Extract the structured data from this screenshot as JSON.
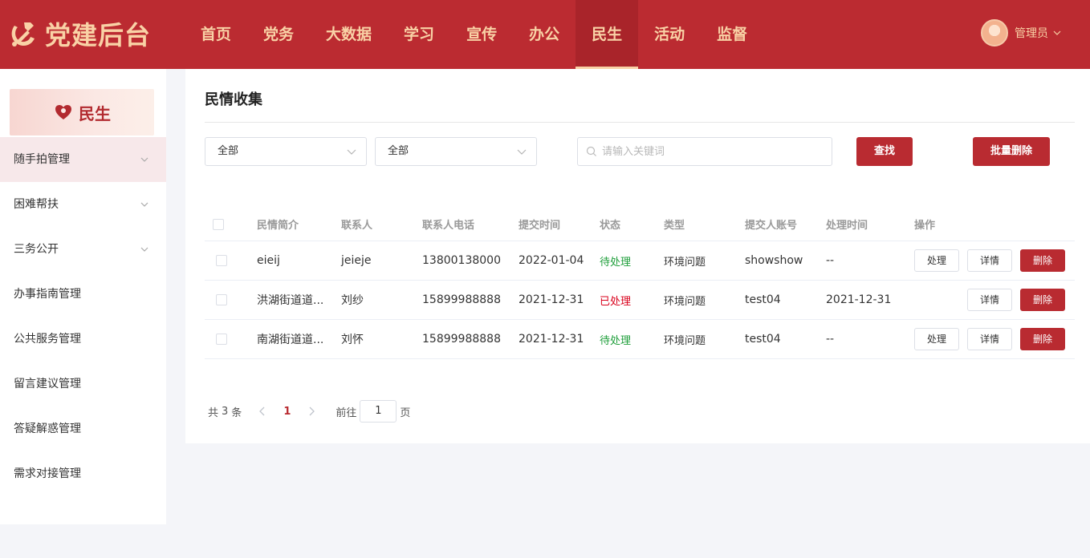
{
  "header": {
    "title": "党建后台",
    "nav": [
      "首页",
      "党务",
      "大数据",
      "学习",
      "宣传",
      "办公",
      "民生",
      "活动",
      "监督"
    ],
    "active_index": 6,
    "user_name": "管理员"
  },
  "sidebar": {
    "banner_title": "民生",
    "items": [
      {
        "label": "随手拍管理",
        "expandable": true,
        "active": true
      },
      {
        "label": "困难帮扶",
        "expandable": true
      },
      {
        "label": "三务公开",
        "expandable": true
      },
      {
        "label": "办事指南管理"
      },
      {
        "label": "公共服务管理"
      },
      {
        "label": "留言建议管理"
      },
      {
        "label": "答疑解惑管理"
      },
      {
        "label": "需求对接管理"
      }
    ]
  },
  "main": {
    "page_title": "民情收集",
    "filter1": "全部",
    "filter2": "全部",
    "search_placeholder": "请输入关键词",
    "search_button": "查找",
    "batch_delete_button": "批量删除"
  },
  "table": {
    "headers": [
      "民情简介",
      "联系人",
      "联系人电话",
      "提交时间",
      "状态",
      "类型",
      "提交人账号",
      "处理时间",
      "操作"
    ],
    "rows": [
      {
        "brief": "eieij",
        "contact": "jeieje",
        "phone": "13800138000",
        "submit_time": "2022-01-04",
        "status": "待处理",
        "type": "环境问题",
        "account": "showshow",
        "handle_time": "--",
        "can_process": true
      },
      {
        "brief": "洪湖街道道...",
        "contact": "刘纱",
        "phone": "15899988888",
        "submit_time": "2021-12-31",
        "status": "已处理",
        "type": "环境问题",
        "account": "test04",
        "handle_time": "2021-12-31",
        "can_process": false
      },
      {
        "brief": "南湖街道道...",
        "contact": "刘怀",
        "phone": "15899988888",
        "submit_time": "2021-12-31",
        "status": "待处理",
        "type": "环境问题",
        "account": "test04",
        "handle_time": "--",
        "can_process": true
      }
    ],
    "actions": {
      "process": "处理",
      "detail": "详情",
      "delete": "删除"
    }
  },
  "pagination": {
    "total_prefix": "共",
    "total": "3",
    "total_suffix": "条",
    "current_page": "1",
    "goto_label": "前往",
    "goto_value": "1",
    "page_suffix": "页"
  },
  "colors": {
    "primary": "#bb2b31",
    "accent": "#f9d2a6",
    "pending": "#1e9e3a",
    "done": "#d9001b"
  }
}
